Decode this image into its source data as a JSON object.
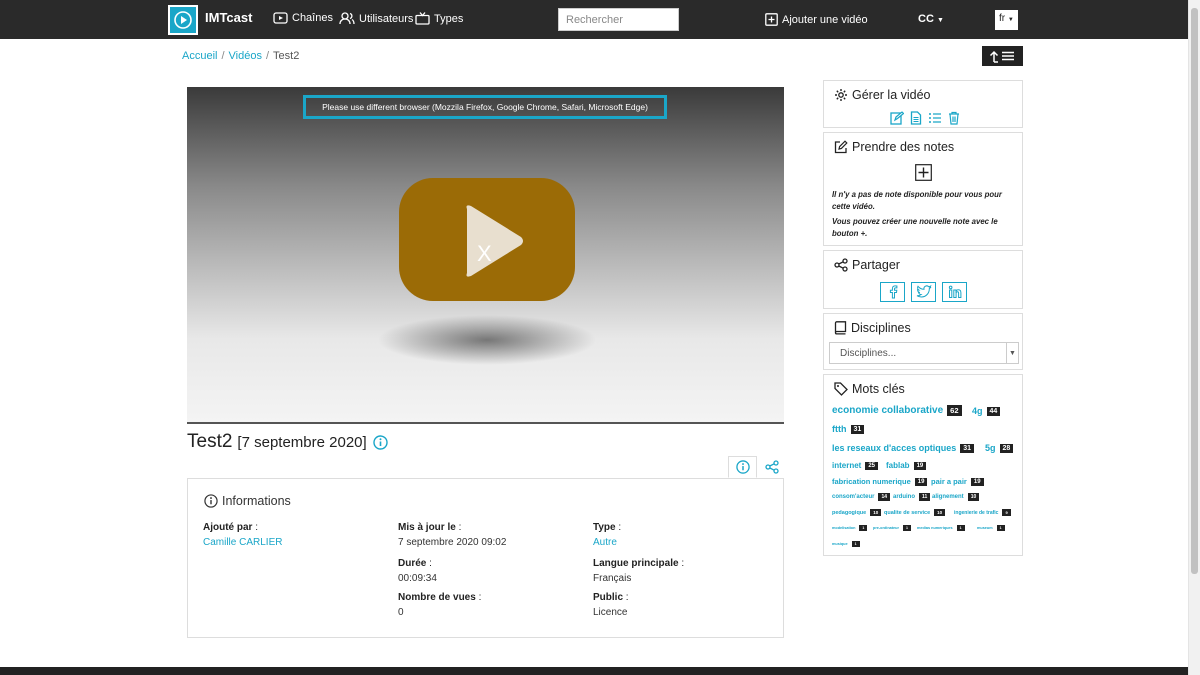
{
  "header": {
    "brand": "IMTcast",
    "nav": {
      "channels": "Chaînes",
      "users": "Utilisateurs",
      "types": "Types"
    },
    "search_placeholder": "Rechercher",
    "add_video": "Ajouter une vidéo",
    "user_menu": "CC",
    "language": "fr"
  },
  "breadcrumb": {
    "home": "Accueil",
    "videos": "Vidéos",
    "current": "Test2"
  },
  "player": {
    "notice": "Please use different browser (Mozzila Firefox, Google Chrome, Safari, Microsoft Edge)",
    "overlay_mark": "X",
    "colors": {
      "accent": "#1aa6c8",
      "play_button": "#9b6b06"
    }
  },
  "video": {
    "title": "Test2",
    "date": "[7 septembre 2020]"
  },
  "info": {
    "heading": "Informations",
    "added_by": {
      "label": "Ajouté par",
      "value": "Camille CARLIER"
    },
    "updated": {
      "label": "Mis à jour le",
      "value": "7 septembre 2020 09:02"
    },
    "type": {
      "label": "Type",
      "value": "Autre"
    },
    "duration": {
      "label": "Durée",
      "value": "00:09:34"
    },
    "language": {
      "label": "Langue principale",
      "value": "Français"
    },
    "views": {
      "label": "Nombre de vues",
      "value": "0"
    },
    "public": {
      "label": "Public",
      "value": "Licence"
    }
  },
  "sidebar": {
    "manage": {
      "title": "Gérer la vidéo"
    },
    "notes": {
      "title": "Prendre des notes",
      "empty": "Il n'y a pas de note disponible pour vous pour cette vidéo.",
      "hint": "Vous pouvez créer une nouvelle note avec le bouton +."
    },
    "share": {
      "title": "Partager"
    },
    "disciplines": {
      "title": "Disciplines",
      "placeholder": "Disciplines..."
    },
    "keywords": {
      "title": "Mots clés",
      "tags": [
        {
          "name": "economie collaborative",
          "count": "62"
        },
        {
          "name": "4g",
          "count": "44"
        },
        {
          "name": "ftth",
          "count": "31"
        },
        {
          "name": "les reseaux d'acces optiques",
          "count": "31"
        },
        {
          "name": "5g",
          "count": "28"
        },
        {
          "name": "internet",
          "count": "25"
        },
        {
          "name": "fablab",
          "count": "19"
        },
        {
          "name": "fabrication numerique",
          "count": "19"
        },
        {
          "name": "pair a pair",
          "count": "19"
        },
        {
          "name": "consom'acteur",
          "count": "14"
        },
        {
          "name": "arduino",
          "count": "11"
        },
        {
          "name": "alignement",
          "count": "10"
        },
        {
          "name": "pedagogique",
          "count": "10"
        },
        {
          "name": "qualite de service",
          "count": "10"
        },
        {
          "name": "ingenierie de trafic",
          "count": "9"
        },
        {
          "name": "modelisation",
          "count": "1"
        },
        {
          "name": "pre-ordinateur",
          "count": "1"
        },
        {
          "name": "medias numeriques",
          "count": "1"
        },
        {
          "name": "museum",
          "count": "1"
        },
        {
          "name": "musique",
          "count": "1"
        }
      ]
    }
  }
}
